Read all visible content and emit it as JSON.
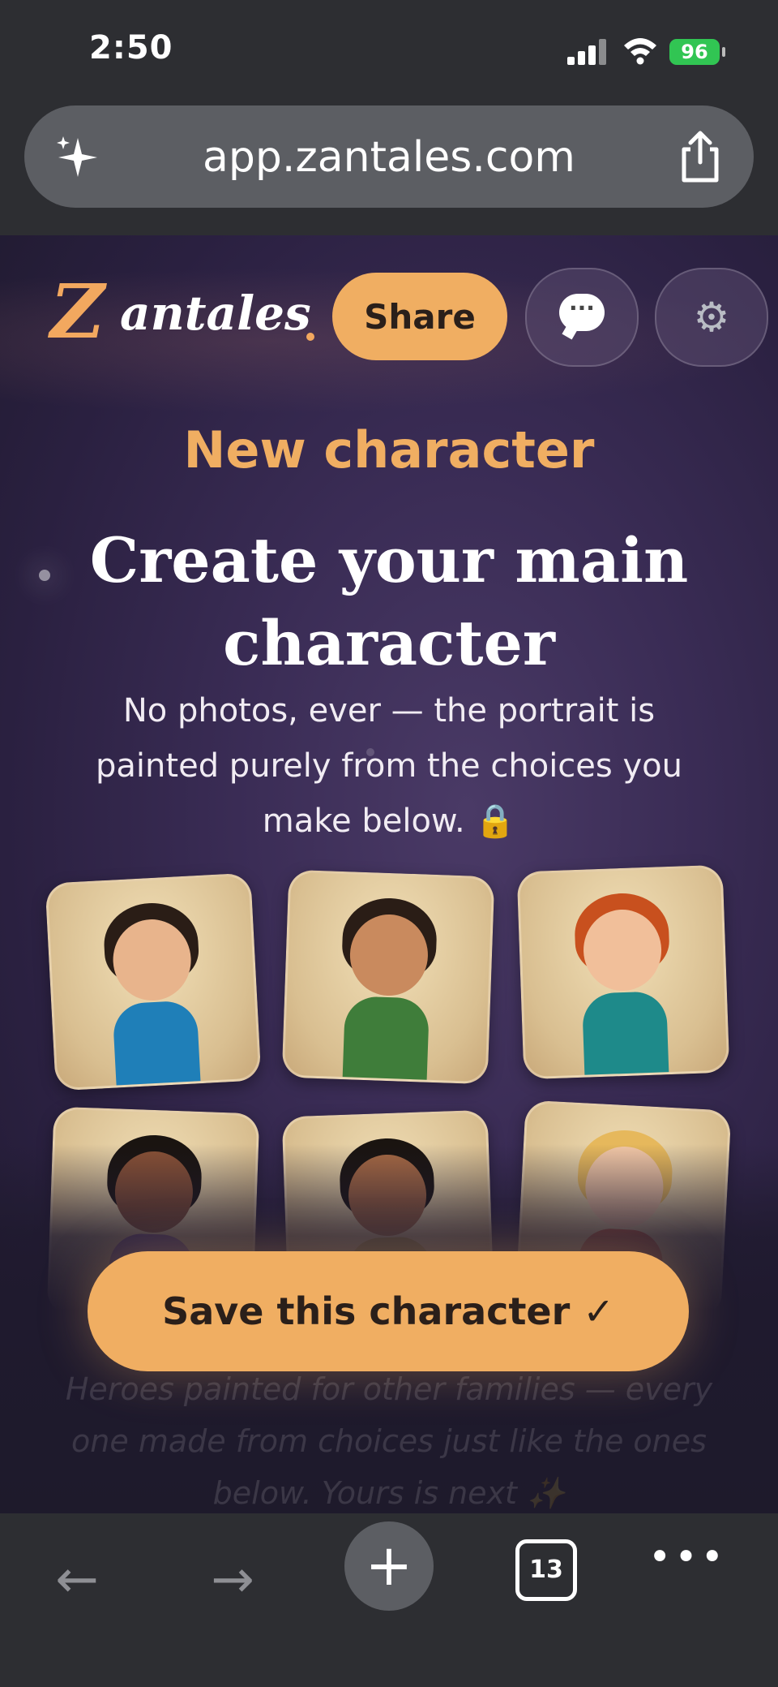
{
  "status_bar": {
    "time": "2:50",
    "battery": "96"
  },
  "browser": {
    "url": "app.zantales.com",
    "tab_count": "13"
  },
  "header": {
    "logo_initial": "Z",
    "logo_rest": "antales",
    "share_label": "Share",
    "chat_icon": "chat-bubble-icon",
    "settings_icon": "gear-icon"
  },
  "main": {
    "kicker": "New character",
    "headline": "Create your main character",
    "subtext": "No photos, ever — the portrait is painted purely from the choices you make below. 🔒",
    "ghost_text": "Heroes painted for other families — every one made from choices just like the ones below. Yours is next ✨",
    "save_label": "Save this character ✓"
  },
  "characters": [
    {
      "name": "boy-with-glasses",
      "hair": "#2a1d16",
      "skin": "#e8b48c",
      "outfit": "#1f7fb8"
    },
    {
      "name": "girl-with-cane",
      "hair": "#2a1d16",
      "skin": "#c98a5e",
      "outfit": "#3f7d3a"
    },
    {
      "name": "curly-redhead-boy",
      "hair": "#c8501e",
      "skin": "#f1bf9a",
      "outfit": "#1e8a8a"
    },
    {
      "name": "laughing-boy",
      "hair": "#1a1410",
      "skin": "#8a5236",
      "outfit": "#6e4aa8"
    },
    {
      "name": "girl-with-braids",
      "hair": "#1a1410",
      "skin": "#a86a44",
      "outfit": "#b9a04a"
    },
    {
      "name": "blonde-girl-wheelchair",
      "hair": "#e6b85c",
      "skin": "#f2c7a6",
      "outfit": "#c8553c"
    }
  ],
  "colors": {
    "accent": "#f0ae62",
    "background": "#2a2040",
    "chrome": "#2d2e32"
  }
}
